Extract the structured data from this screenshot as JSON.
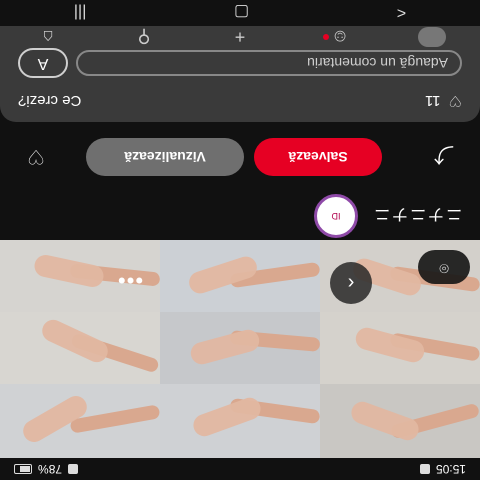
{
  "status_bar": {
    "time": "15:05",
    "right_text": "78%"
  },
  "grid": {
    "images": [
      {
        "id": "1"
      },
      {
        "id": "2"
      },
      {
        "id": "3"
      },
      {
        "id": "4"
      },
      {
        "id": "5"
      },
      {
        "id": "6"
      },
      {
        "id": "7"
      },
      {
        "id": "8"
      },
      {
        "id": "9"
      }
    ],
    "back_icon": "‹",
    "more_icon": "•••",
    "lens_icon": "⌾"
  },
  "author": {
    "name": "ニナニナニ",
    "avatar_label": "ID"
  },
  "actions": {
    "save_label": "Salvează",
    "view_label": "Vizualizează",
    "share_icon": "⤴",
    "react_icon": "♡"
  },
  "comments": {
    "title": "Ce crezi?",
    "like_count": "11",
    "placeholder": "Adaugă un comentariu",
    "avatar_letter": "A"
  },
  "bottom_nav": {
    "home_icon": "⌂",
    "search_icon": "⚲",
    "plus_icon": "+",
    "messages_icon": "☺"
  },
  "system_nav": {
    "back": "<",
    "home": "▢",
    "recents": "|||"
  },
  "colors": {
    "accent": "#e60023",
    "surface": "#3a3a3a",
    "button_gray": "#6f6f6f"
  }
}
